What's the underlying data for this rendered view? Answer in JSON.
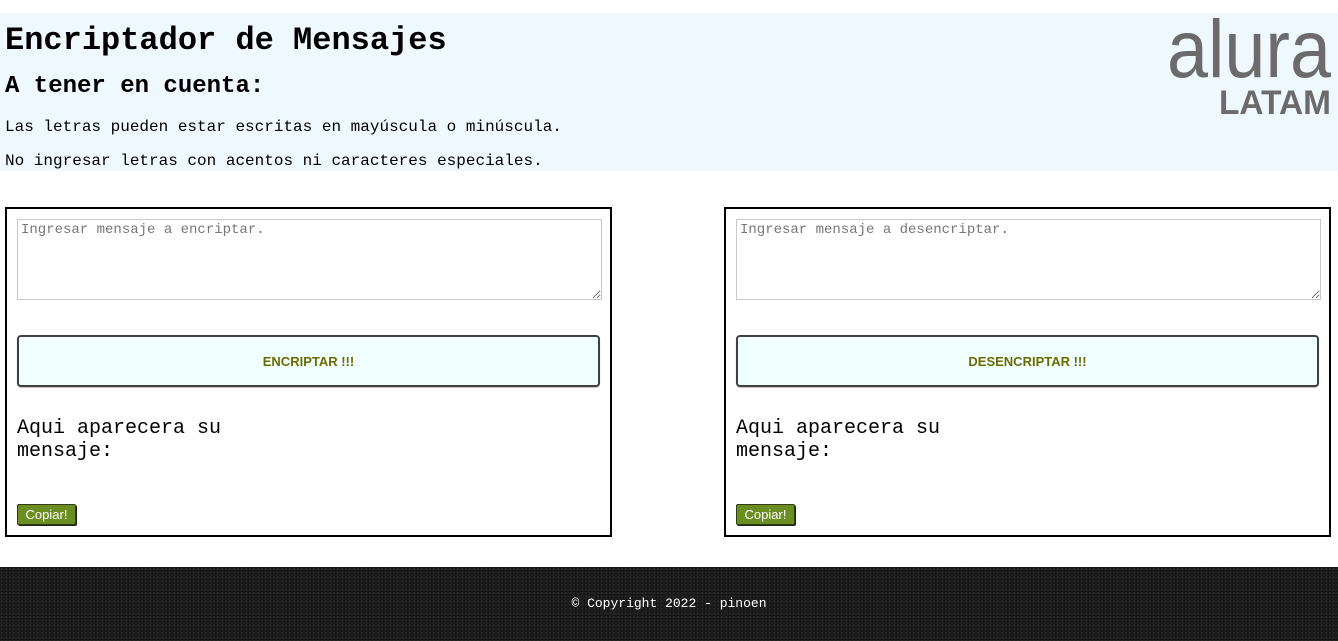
{
  "header": {
    "title": "Encriptador de Mensajes",
    "subtitle": "A tener en cuenta:",
    "notes": [
      "Las letras pueden estar escritas en mayúscula o minúscula.",
      "No ingresar letras con acentos ni caracteres especiales."
    ],
    "logo": {
      "icon": "alura-latam-logo",
      "line1": "alura",
      "line2": "LATAM",
      "color": "#6b6b6b"
    }
  },
  "encrypt_panel": {
    "input_value": "",
    "input_placeholder": "Ingresar mensaje a encriptar.",
    "button_label": "ENCRIPTAR !!!",
    "result_text": "Aqui aparecera su mensaje:",
    "copy_label": "Copiar!"
  },
  "decrypt_panel": {
    "input_value": "",
    "input_placeholder": "Ingresar mensaje a desencriptar.",
    "button_label": "DESENCRIPTAR !!!",
    "result_text": "Aqui aparecera su mensaje:",
    "copy_label": "Copiar!"
  },
  "footer": {
    "text": "© Copyright 2022 - pinoen"
  },
  "colors": {
    "header_bg": "#f0f8ff",
    "action_button_bg": "#f0ffff",
    "action_button_text": "#6b6b00",
    "copy_button_bg": "#6b8e23",
    "footer_bg": "#1e1e1e"
  }
}
